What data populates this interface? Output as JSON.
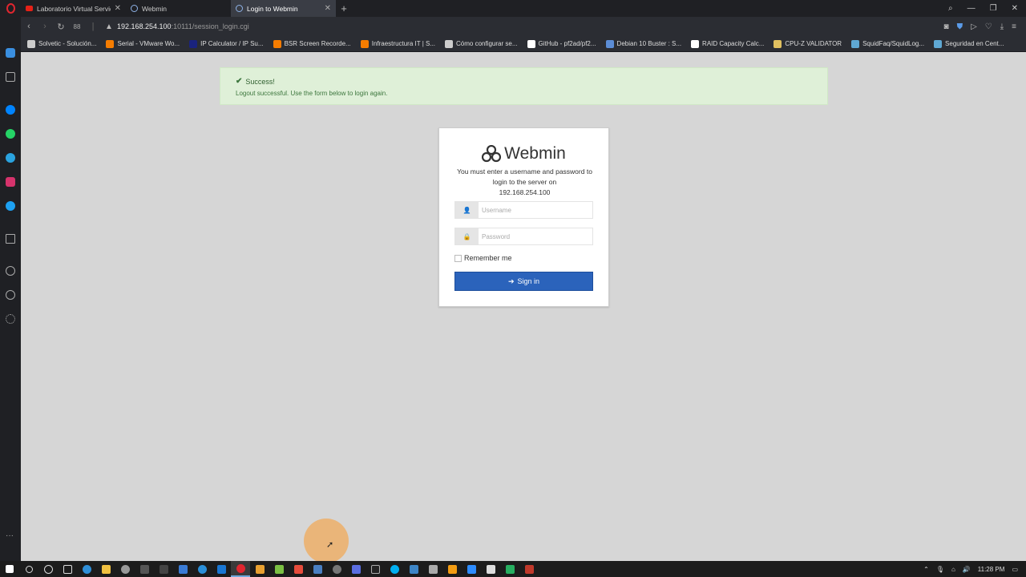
{
  "browser": {
    "tabs": [
      {
        "label": "Laboratorio Virtual Servidor",
        "favicon": "youtube-icon",
        "active": false
      },
      {
        "label": "Webmin",
        "favicon": "webmin-icon",
        "active": false
      },
      {
        "label": "Login to Webmin",
        "favicon": "webmin-icon",
        "active": true
      }
    ],
    "address": {
      "host": "192.168.254.100",
      "rest": ":10111/session_login.cgi"
    },
    "bookmarks": [
      {
        "label": "Solvetic - Solución...",
        "color": "#cccccc"
      },
      {
        "label": "Serial - VMware Wo...",
        "color": "#f57c00"
      },
      {
        "label": "IP Calculator / IP Su...",
        "color": "#1a237e"
      },
      {
        "label": "BSR Screen Recorde...",
        "color": "#f57c00"
      },
      {
        "label": "Infraestructura IT | S...",
        "color": "#f57c00"
      },
      {
        "label": "Cómo configurar se...",
        "color": "#cccccc"
      },
      {
        "label": "GitHub - pf2ad/pf2...",
        "color": "#ffffff"
      },
      {
        "label": "Debian 10 Buster : S...",
        "color": "#5c8dd6"
      },
      {
        "label": "RAID Capacity Calc...",
        "color": "#ffffff"
      },
      {
        "label": "CPU-Z VALIDATOR",
        "color": "#e0c060"
      },
      {
        "label": "SquidFaq/SquidLog...",
        "color": "#5fa8d3"
      },
      {
        "label": "Seguridad en Cent...",
        "color": "#5fa8d3"
      }
    ]
  },
  "alert": {
    "title": "Success!",
    "message": "Logout successful. Use the form below to login again."
  },
  "login": {
    "brand": "Webmin",
    "intro": "You must enter a username and password to login to the server on",
    "host": "192.168.254.100",
    "username_placeholder": "Username",
    "password_placeholder": "Password",
    "remember_label": "Remember me",
    "signin_label": "Sign in"
  },
  "taskbar": {
    "time": "11:28 PM"
  },
  "colors": {
    "accent": "#2b63bb",
    "success_bg": "#dff0d8",
    "success_text": "#3c763d"
  }
}
